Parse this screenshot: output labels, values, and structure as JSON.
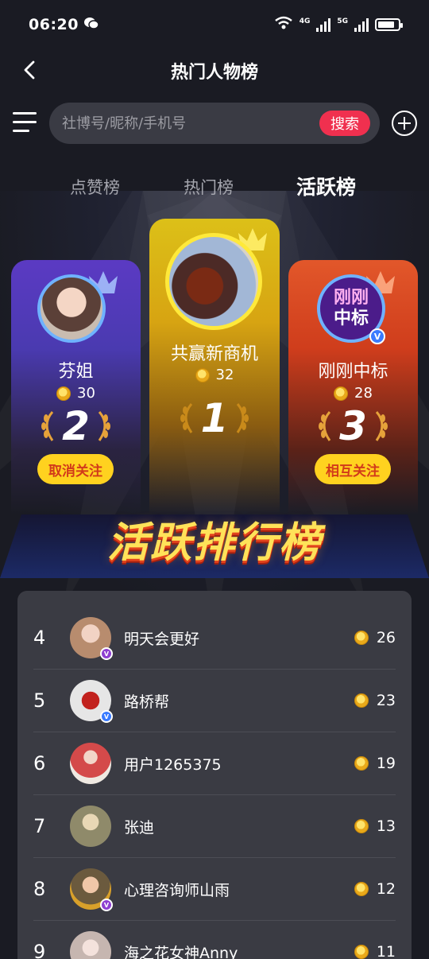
{
  "status": {
    "time": "06:20",
    "network1": "4G",
    "network2": "5G"
  },
  "nav": {
    "title": "热门人物榜"
  },
  "search": {
    "placeholder": "社博号/昵称/手机号",
    "button": "搜索"
  },
  "tabs": [
    {
      "label": "点赞榜",
      "active": false
    },
    {
      "label": "热门榜",
      "active": false
    },
    {
      "label": "活跃榜",
      "active": true
    }
  ],
  "podium": [
    {
      "rank": "2",
      "name": "芬姐",
      "score": "30",
      "action": "取消关注"
    },
    {
      "rank": "1",
      "name": "共赢新商机",
      "score": "32",
      "action": ""
    },
    {
      "rank": "3",
      "name": "刚刚中标",
      "score": "28",
      "action": "相互关注",
      "avatar_text_top": "刚刚",
      "avatar_text_bottom": "中标"
    }
  ],
  "banner": "活跃排行榜",
  "list": [
    {
      "rank": "4",
      "name": "明天会更好",
      "score": "26",
      "badge": "V",
      "badge_color": "#8e3fd1",
      "avatar_color": "#b88c6e"
    },
    {
      "rank": "5",
      "name": "路桥帮",
      "score": "23",
      "badge": "V",
      "badge_color": "#3a7bff",
      "avatar_color": "#e6e6e6"
    },
    {
      "rank": "6",
      "name": "用户1265375",
      "score": "19",
      "badge": "",
      "badge_color": "",
      "avatar_color": "#d44a4a"
    },
    {
      "rank": "7",
      "name": "张迪",
      "score": "13",
      "badge": "",
      "badge_color": "",
      "avatar_color": "#8f8a6a"
    },
    {
      "rank": "8",
      "name": "心理咨询师山雨",
      "score": "12",
      "badge": "V",
      "badge_color": "#8e3fd1",
      "avatar_color": "#6b5a3e"
    },
    {
      "rank": "9",
      "name": "海之花女神Anny",
      "score": "11",
      "badge": "",
      "badge_color": "",
      "avatar_color": "#c6b6b0"
    }
  ]
}
